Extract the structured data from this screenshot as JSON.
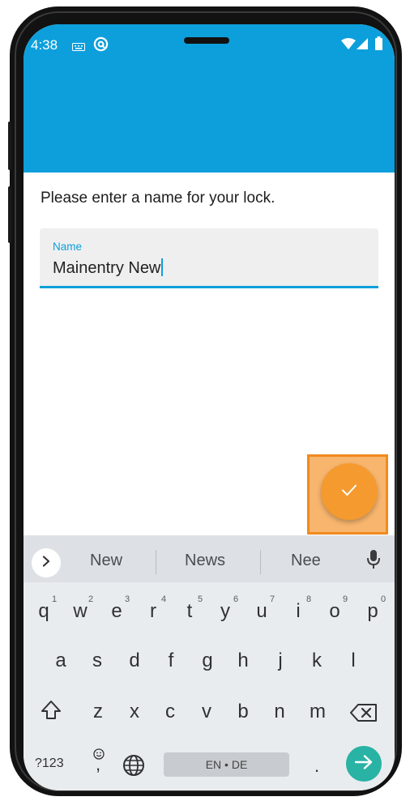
{
  "status_bar": {
    "time": "4:38"
  },
  "form": {
    "prompt": "Please enter a name for your lock.",
    "field_label": "Name",
    "field_value": "Mainentry New"
  },
  "keyboard": {
    "suggestions": [
      "New",
      "News",
      "Nee"
    ],
    "row1": [
      {
        "key": "q",
        "hint": "1"
      },
      {
        "key": "w",
        "hint": "2"
      },
      {
        "key": "e",
        "hint": "3"
      },
      {
        "key": "r",
        "hint": "4"
      },
      {
        "key": "t",
        "hint": "5"
      },
      {
        "key": "y",
        "hint": "6"
      },
      {
        "key": "u",
        "hint": "7"
      },
      {
        "key": "i",
        "hint": "8"
      },
      {
        "key": "o",
        "hint": "9"
      },
      {
        "key": "p",
        "hint": "0"
      }
    ],
    "row2": [
      "a",
      "s",
      "d",
      "f",
      "g",
      "h",
      "j",
      "k",
      "l"
    ],
    "row3": [
      "z",
      "x",
      "c",
      "v",
      "b",
      "n",
      "m"
    ],
    "symbols_key": "?123",
    "comma_key": ",",
    "space_label": "EN • DE",
    "period_key": "."
  },
  "icons": {
    "keyboard_status": "keyboard-icon",
    "at_status": "at-sign-icon",
    "wifi": "wifi-icon",
    "signal": "signal-icon",
    "battery": "battery-icon",
    "confirm": "check-icon",
    "expand": "chevron-right-icon",
    "mic": "mic-icon",
    "shift": "shift-icon",
    "backspace": "backspace-icon",
    "emoji": "emoji-icon",
    "globe": "globe-icon",
    "enter": "arrow-right-icon"
  },
  "colors": {
    "app_bar": "#0d9fdb",
    "accent": "#0d9fdb",
    "fab": "#f59a2f",
    "highlight_border": "#f18a1c",
    "enter_key": "#28b3a4"
  }
}
